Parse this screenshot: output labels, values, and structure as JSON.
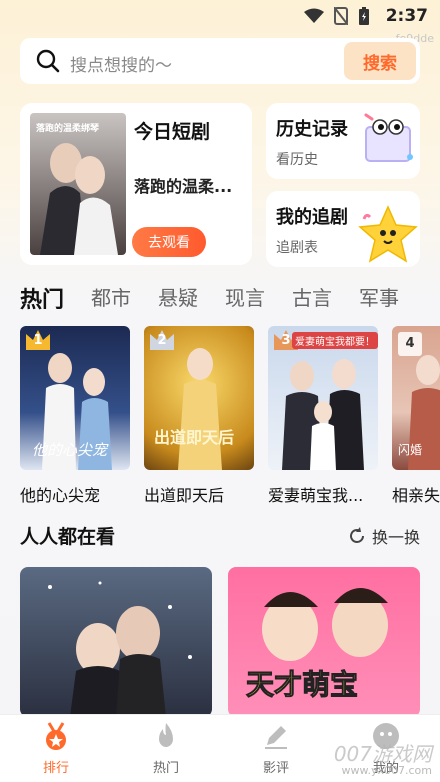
{
  "status_bar": {
    "time": "2:37"
  },
  "watermark_top": "fe9dde",
  "search": {
    "placeholder": "搜点想搜的～",
    "button": "搜索"
  },
  "today": {
    "title": "今日短剧",
    "drama": "落跑的温柔...",
    "watch": "去观看",
    "poster_text": "落跑的温柔绑琴"
  },
  "history": {
    "title": "历史记录",
    "sub": "看历史"
  },
  "follow": {
    "title": "我的追剧",
    "sub": "追剧表"
  },
  "tabs": [
    "热门",
    "都市",
    "悬疑",
    "现言",
    "古言",
    "军事"
  ],
  "hot": [
    {
      "rank": "1",
      "name": "他的心尖宠",
      "cover_text": "他的心尖宠"
    },
    {
      "rank": "2",
      "name": "出道即天后",
      "cover_text": "出道即天后"
    },
    {
      "rank": "3",
      "name": "爱妻萌宝我...",
      "cover_text": "爱妻萌宝我都要！"
    },
    {
      "rank": "4",
      "name": "相亲失",
      "cover_text": "闪婚"
    }
  ],
  "section": {
    "title": "人人都在看",
    "refresh": "换一换"
  },
  "feed_right_text": "天才萌宝",
  "nav": [
    {
      "label": "排行"
    },
    {
      "label": "热门"
    },
    {
      "label": "影评"
    },
    {
      "label": "我的"
    }
  ],
  "watermark_bottom": "007游戏网",
  "watermark_url": "www.yx007.com",
  "colors": {
    "accent": "#ff6a2b",
    "search_btn_bg": "#fde3c6"
  }
}
